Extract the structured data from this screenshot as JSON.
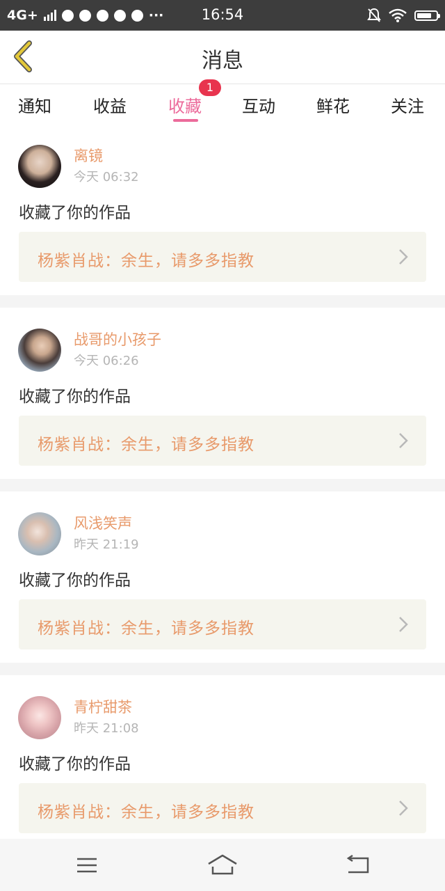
{
  "status_bar": {
    "network": "4G+",
    "time": "16:54",
    "dots": "···"
  },
  "header": {
    "title": "消息"
  },
  "tabs": [
    {
      "label": "通知"
    },
    {
      "label": "收益"
    },
    {
      "label": "收藏",
      "active": true,
      "badge": "1"
    },
    {
      "label": "互动"
    },
    {
      "label": "鲜花"
    },
    {
      "label": "关注"
    }
  ],
  "messages": [
    {
      "username": "离镜",
      "time": "今天 06:32",
      "action": "收藏了你的作品",
      "work_title": "杨紫肖战：余生，请多多指教"
    },
    {
      "username": "战哥的小孩子",
      "time": "今天 06:26",
      "action": "收藏了你的作品",
      "work_title": "杨紫肖战：余生，请多多指教"
    },
    {
      "username": "风浅笑声",
      "time": "昨天 21:19",
      "action": "收藏了你的作品",
      "work_title": "杨紫肖战：余生，请多多指教"
    },
    {
      "username": "青柠甜茶",
      "time": "昨天 21:08",
      "action": "收藏了你的作品",
      "work_title": "杨紫肖战：余生，请多多指教"
    }
  ],
  "colors": {
    "accent": "#ec6b9b",
    "username": "#e89a6b",
    "badge": "#e8344e",
    "back_arrow": "#e3c83a"
  }
}
